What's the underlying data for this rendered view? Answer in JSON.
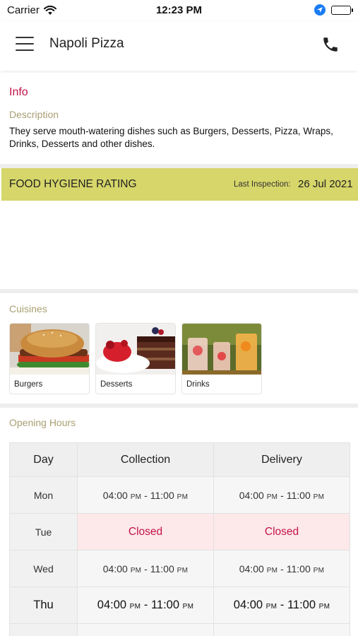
{
  "status_bar": {
    "carrier": "Carrier",
    "time": "12:23 PM"
  },
  "header": {
    "title": "Napoli Pizza",
    "menu_icon": "hamburger-menu-icon",
    "call_icon": "phone-icon"
  },
  "info": {
    "heading": "Info",
    "description_label": "Description",
    "description": "They serve mouth-watering dishes such as Burgers, Desserts, Pizza, Wraps, Drinks, Desserts and other dishes."
  },
  "hygiene": {
    "title": "FOOD HYGIENE RATING",
    "last_inspection_label": "Last Inspection:",
    "last_inspection_date": "26 Jul 2021",
    "background": "#d6d66a"
  },
  "cuisines": {
    "heading": "Cuisines",
    "items": [
      {
        "label": "Burgers"
      },
      {
        "label": "Desserts"
      },
      {
        "label": "Drinks"
      }
    ]
  },
  "hours": {
    "heading": "Opening Hours",
    "columns": [
      "Day",
      "Collection",
      "Delivery"
    ],
    "rows": [
      {
        "day": "Mon",
        "collection": {
          "start": "04:00",
          "start_suffix": "PM",
          "sep": " - ",
          "end": "11:00",
          "end_suffix": "PM"
        },
        "delivery": {
          "start": "04:00",
          "start_suffix": "PM",
          "sep": " - ",
          "end": "11:00",
          "end_suffix": "PM"
        }
      },
      {
        "day": "Tue",
        "collection_closed": "Closed",
        "delivery_closed": "Closed"
      },
      {
        "day": "Wed",
        "collection": {
          "start": "04:00",
          "start_suffix": "PM",
          "sep": " - ",
          "end": "11:00",
          "end_suffix": "PM"
        },
        "delivery": {
          "start": "04:00",
          "start_suffix": "PM",
          "sep": " - ",
          "end": "11:00",
          "end_suffix": "PM"
        }
      },
      {
        "day": "Thu",
        "collection": {
          "start": "04:00",
          "start_suffix": "PM",
          "sep": " - ",
          "end": "11:00",
          "end_suffix": "PM"
        },
        "delivery": {
          "start": "04:00",
          "start_suffix": "PM",
          "sep": " - ",
          "end": "11:00",
          "end_suffix": "PM"
        }
      }
    ]
  },
  "colors": {
    "accent": "#c4124a",
    "label": "#a99f73",
    "closed_bg": "#fde8ea"
  }
}
